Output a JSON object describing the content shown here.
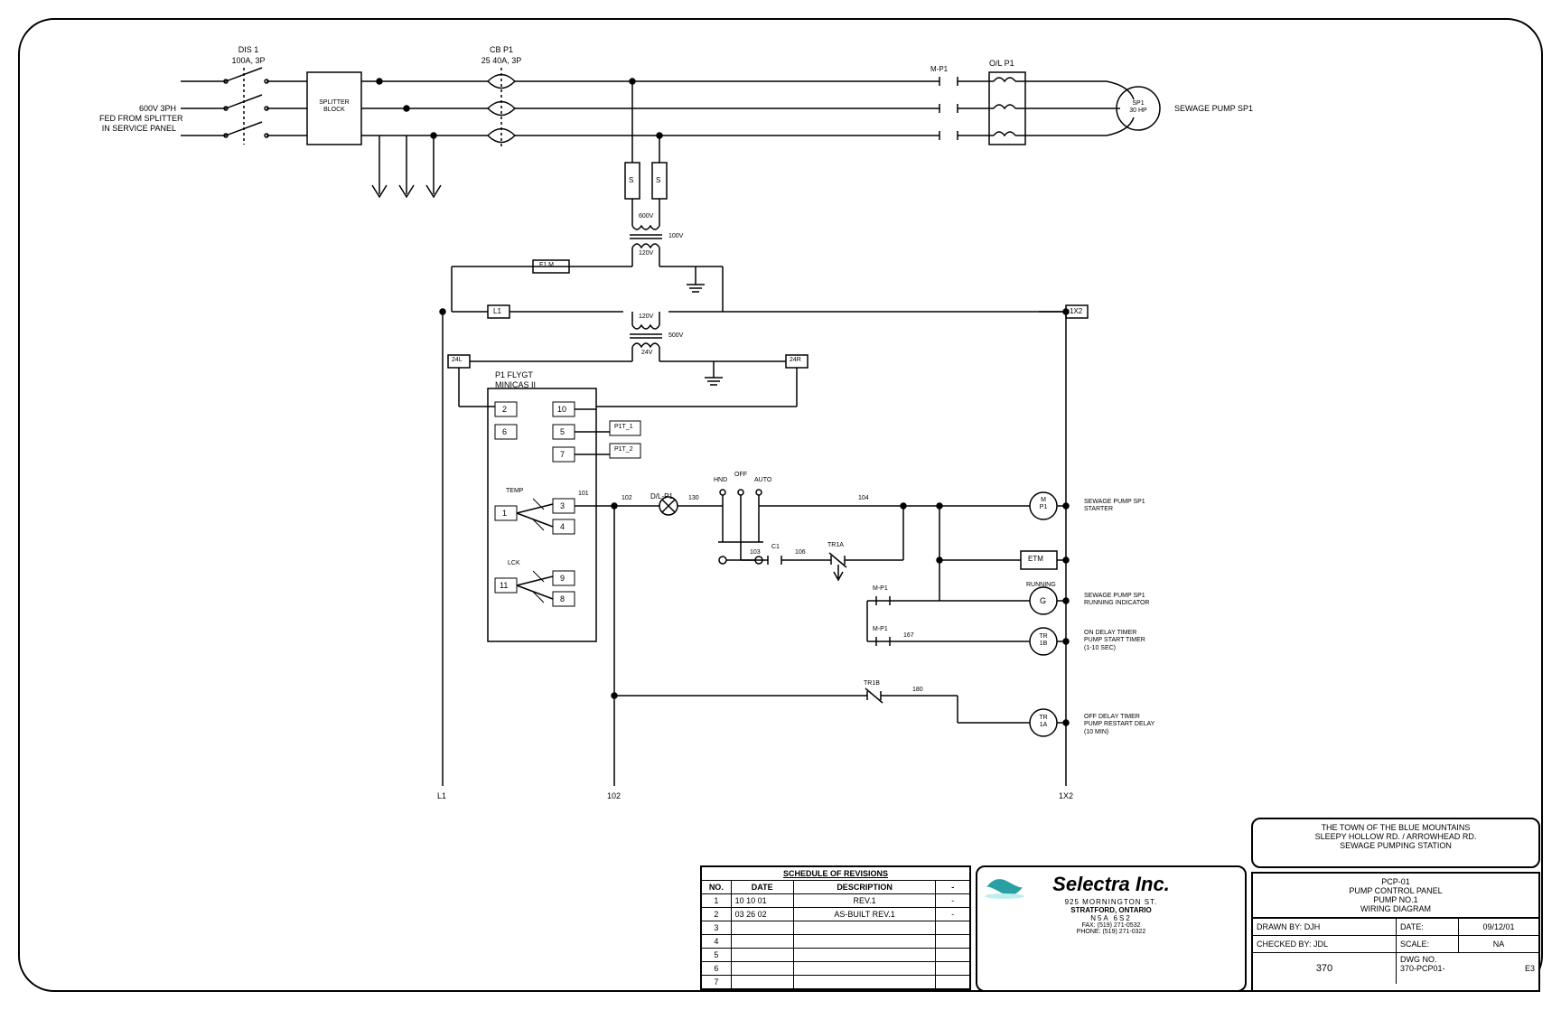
{
  "power": {
    "source_note": "600V 3PH\nFED FROM SPLITTER\nIN SERVICE PANEL",
    "dis1_label": "DIS 1",
    "dis1_rating": "100A, 3P",
    "splitter": "SPLITTER\nBLOCK",
    "cb_label": "CB P1",
    "cb_rating": "25 40A, 3P",
    "mp1": "M-P1",
    "ol": "O/L P1",
    "pump": "SP1\n30 HP",
    "pump_desc": "SEWAGE PUMP SP1"
  },
  "xfmr": {
    "fuse_s": "S",
    "v600": "600V",
    "v100": "100V",
    "v120": "120V",
    "f1m": "F1 M",
    "l1": "L1",
    "x2": "1X2",
    "v24": "24V",
    "v500": "500V",
    "b24l": "24L",
    "b24r": "24R"
  },
  "minicas": {
    "title": "P1 FLYGT\nMINICAS II",
    "t2": "2",
    "t6": "6",
    "t10": "10",
    "t5": "5",
    "t7": "7",
    "ptt1": "P1T_1",
    "ptt2": "P1T_2",
    "temp": "TEMP",
    "t1": "1",
    "t3": "3",
    "t4": "4",
    "lk": "LCK",
    "t11": "11",
    "t9": "9",
    "t8": "8",
    "n101": "101"
  },
  "ctrl": {
    "n102a": "102",
    "dl": "D/L-P1",
    "n130": "130",
    "hnd": "HND",
    "off": "OFF",
    "auto": "AUTO",
    "n103": "103",
    "c1": "C1",
    "n106": "106",
    "tr1a": "TR1A",
    "n104": "104",
    "mp1_coil": "M\nP1",
    "mp1_coil_desc": "SEWAGE PUMP SP1\nSTARTER",
    "etm": "ETM",
    "g": "G",
    "running": "RUNNING",
    "g_desc": "SEWAGE PUMP SP1\nRUNNING INDICATOR",
    "mp1c": "M-P1",
    "n167": "167",
    "tr1b": "TR\n1B",
    "tr1b_desc": "ON DELAY TIMER\nPUMP START TIMER\n(1-10 SEC)",
    "tr1b_c": "TR1B",
    "n180": "180",
    "tr1a_coil": "TR\n1A",
    "tr1a_desc": "OFF DELAY TIMER\nPUMP RESTART DELAY\n(10 MIN)"
  },
  "rails": {
    "l1": "L1",
    "n102": "102",
    "x2": "1X2"
  },
  "revtable": {
    "title": "SCHEDULE OF REVISIONS",
    "cols": [
      "NO.",
      "DATE",
      "DESCRIPTION",
      "-"
    ],
    "rows": [
      [
        "1",
        "10 10 01",
        "REV.1",
        "-"
      ],
      [
        "2",
        "03 26 02",
        "AS-BUILT REV.1",
        "-"
      ],
      [
        "3",
        "",
        "",
        ""
      ],
      [
        "4",
        "",
        "",
        ""
      ],
      [
        "5",
        "",
        "",
        ""
      ],
      [
        "6",
        "",
        "",
        ""
      ],
      [
        "7",
        "",
        "",
        ""
      ]
    ]
  },
  "company": {
    "name": "Selectra Inc.",
    "addr1": "925 MORNINGTON ST.",
    "addr2": "STRATFORD, ONTARIO",
    "addr3": "N5A 6S2",
    "fax": "FAX: (519) 271-0532",
    "phone": "PHONE: (519) 271-0322"
  },
  "title1": {
    "l1": "THE TOWN OF THE BLUE MOUNTAINS",
    "l2": "SLEEPY HOLLOW RD. / ARROWHEAD RD.",
    "l3": "SEWAGE PUMPING STATION"
  },
  "title2": {
    "l1": "PCP-01",
    "l2": "PUMP CONTROL PANEL",
    "l3": "PUMP NO.1",
    "l4": "WIRING DIAGRAM"
  },
  "tb": {
    "drawn_l": "DRAWN BY:",
    "drawn_v": "DJH",
    "checked_l": "CHECKED BY:",
    "checked_v": "JDL",
    "proj": "370",
    "date_l": "DATE:",
    "date_v": "09/12/01",
    "scale_l": "SCALE:",
    "scale_v": "NA",
    "dwg_l": "DWG NO.",
    "dwg_v": "370-PCP01-",
    "dwg_sh": "E3"
  }
}
